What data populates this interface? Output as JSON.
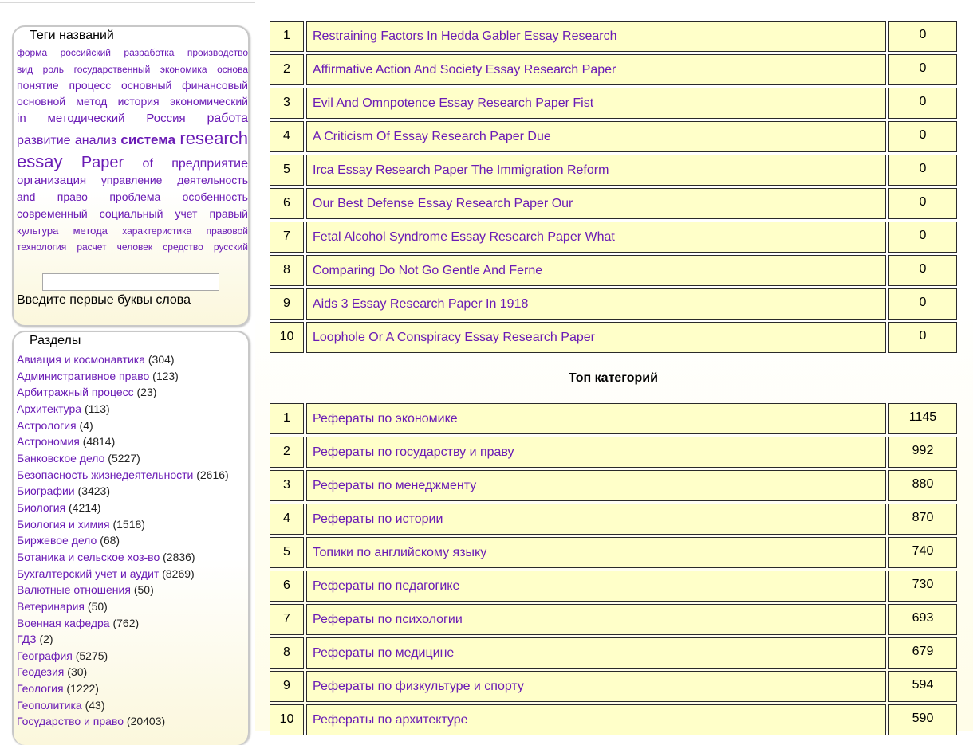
{
  "tags_box": {
    "title": "Теги названий",
    "lines": [
      [
        {
          "t": "форма",
          "s": 12
        },
        {
          "t": "российский",
          "s": 12
        },
        {
          "t": "разработка",
          "s": 12
        },
        {
          "t": "производство",
          "s": 12
        }
      ],
      [
        {
          "t": "вид",
          "s": 12
        },
        {
          "t": "роль",
          "s": 12
        },
        {
          "t": "государственный",
          "s": 12
        },
        {
          "t": "экономика",
          "s": 12
        },
        {
          "t": "основа",
          "s": 12
        }
      ],
      [
        {
          "t": "понятие",
          "s": 14
        },
        {
          "t": "процесс",
          "s": 14
        },
        {
          "t": "основный",
          "s": 14
        },
        {
          "t": "финансовый",
          "s": 14
        }
      ],
      [
        {
          "t": "основной",
          "s": 14
        },
        {
          "t": "метод",
          "s": 14
        },
        {
          "t": "история",
          "s": 14
        },
        {
          "t": "экономический",
          "s": 14
        }
      ],
      [
        {
          "t": "in",
          "s": 15
        },
        {
          "t": "методический",
          "s": 15
        },
        {
          "t": "Россия",
          "s": 15
        },
        {
          "t": "работа",
          "s": 16
        }
      ],
      [
        {
          "t": "развитие",
          "s": 16
        },
        {
          "t": "анализ",
          "s": 16
        },
        {
          "t": "система",
          "s": 17,
          "b": true
        },
        {
          "t": "research",
          "s": 22
        }
      ],
      [
        {
          "t": "essay",
          "s": 22
        },
        {
          "t": "Paper",
          "s": 20
        },
        {
          "t": "of",
          "s": 16
        },
        {
          "t": "предприятие",
          "s": 16
        }
      ],
      [
        {
          "t": "организация",
          "s": 15
        },
        {
          "t": "управление",
          "s": 14
        },
        {
          "t": "деятельность",
          "s": 14
        }
      ],
      [
        {
          "t": "and",
          "s": 14
        },
        {
          "t": "право",
          "s": 14
        },
        {
          "t": "проблема",
          "s": 14
        },
        {
          "t": "особенность",
          "s": 14
        }
      ],
      [
        {
          "t": "современный",
          "s": 14
        },
        {
          "t": "социальный",
          "s": 14
        },
        {
          "t": "учет",
          "s": 14
        },
        {
          "t": "правый",
          "s": 14
        }
      ],
      [
        {
          "t": "культура",
          "s": 13
        },
        {
          "t": "метода",
          "s": 13
        },
        {
          "t": "характеристика",
          "s": 12
        },
        {
          "t": "правовой",
          "s": 12
        }
      ],
      [
        {
          "t": "технология",
          "s": 12
        },
        {
          "t": "расчет",
          "s": 12
        },
        {
          "t": "человек",
          "s": 12
        },
        {
          "t": "средство",
          "s": 12
        },
        {
          "t": "русский",
          "s": 12
        }
      ]
    ],
    "input_value": "",
    "hint": "Введите первые буквы слова"
  },
  "sections_box": {
    "title": "Разделы",
    "items": [
      {
        "name": "Авиация и космонавтика",
        "count": "(304)"
      },
      {
        "name": "Административное право",
        "count": "(123)"
      },
      {
        "name": "Арбитражный процесс",
        "count": "(23)"
      },
      {
        "name": "Архитектура",
        "count": "(113)"
      },
      {
        "name": "Астрология",
        "count": "(4)"
      },
      {
        "name": "Астрономия",
        "count": "(4814)"
      },
      {
        "name": "Банковское дело",
        "count": "(5227)"
      },
      {
        "name": "Безопасность жизнедеятельности",
        "count": "(2616)"
      },
      {
        "name": "Биографии",
        "count": "(3423)"
      },
      {
        "name": "Биология",
        "count": "(4214)"
      },
      {
        "name": "Биология и химия",
        "count": "(1518)"
      },
      {
        "name": "Биржевое дело",
        "count": "(68)"
      },
      {
        "name": "Ботаника и сельское хоз-во",
        "count": "(2836)"
      },
      {
        "name": "Бухгалтерский учет и аудит",
        "count": "(8269)"
      },
      {
        "name": "Валютные отношения",
        "count": "(50)"
      },
      {
        "name": "Ветеринария",
        "count": "(50)"
      },
      {
        "name": "Военная кафедра",
        "count": "(762)"
      },
      {
        "name": "ГДЗ",
        "count": "(2)"
      },
      {
        "name": "География",
        "count": "(5275)"
      },
      {
        "name": "Геодезия",
        "count": "(30)"
      },
      {
        "name": "Геология",
        "count": "(1222)"
      },
      {
        "name": "Геополитика",
        "count": "(43)"
      },
      {
        "name": "Государство и право",
        "count": "(20403)"
      }
    ]
  },
  "top_papers": [
    {
      "num": "1",
      "title": "Restraining Factors In Hedda Gabler Essay Research",
      "count": "0"
    },
    {
      "num": "2",
      "title": "Affirmative Action And Society Essay Research Paper",
      "count": "0"
    },
    {
      "num": "3",
      "title": "Evil And Omnpotence Essay Research Paper Fist",
      "count": "0"
    },
    {
      "num": "4",
      "title": "A Criticism Of Essay Research Paper Due",
      "count": "0"
    },
    {
      "num": "5",
      "title": "Irca Essay Research Paper The Immigration Reform",
      "count": "0"
    },
    {
      "num": "6",
      "title": "Our Best Defense Essay Research Paper Our",
      "count": "0"
    },
    {
      "num": "7",
      "title": "Fetal Alcohol Syndrome Essay Research Paper What",
      "count": "0"
    },
    {
      "num": "8",
      "title": "Comparing Do Not Go Gentle And Ferne",
      "count": "0"
    },
    {
      "num": "9",
      "title": "Aids 3 Essay Research Paper In 1918",
      "count": "0"
    },
    {
      "num": "10",
      "title": "Loophole Or A Conspiracy Essay Research Paper",
      "count": "0"
    }
  ],
  "top_categories_heading": "Топ категорий",
  "top_categories": [
    {
      "num": "1",
      "title": "Рефераты по экономике",
      "count": "1145"
    },
    {
      "num": "2",
      "title": "Рефераты по государству и праву",
      "count": "992"
    },
    {
      "num": "3",
      "title": "Рефераты по менеджменту",
      "count": "880"
    },
    {
      "num": "4",
      "title": "Рефераты по истории",
      "count": "870"
    },
    {
      "num": "5",
      "title": "Топики по английскому языку",
      "count": "740"
    },
    {
      "num": "6",
      "title": "Рефераты по педагогике",
      "count": "730"
    },
    {
      "num": "7",
      "title": "Рефераты по психологии",
      "count": "693"
    },
    {
      "num": "8",
      "title": "Рефераты по медицине",
      "count": "679"
    },
    {
      "num": "9",
      "title": "Рефераты по физкультуре и спорту",
      "count": "594"
    },
    {
      "num": "10",
      "title": "Рефераты по архитектуре",
      "count": "590"
    }
  ],
  "colors": {
    "link": "#6a1bb5",
    "cell_bg": "#ffffc9",
    "cell_border": "#2a2a2a"
  }
}
